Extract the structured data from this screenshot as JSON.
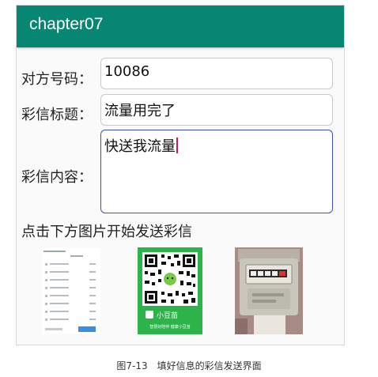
{
  "appbar": {
    "title": "chapter07"
  },
  "form": {
    "phone_label": "对方号码：",
    "phone_value": "10086",
    "subject_label": "彩信标题：",
    "subject_value": "流量用完了",
    "content_label": "彩信内容：",
    "content_value": "快送我流量"
  },
  "hint": "点击下方图片开始发送彩信",
  "qr": {
    "brand": "小豆苗",
    "slogan": "智慧好陪伴 健康小豆苗"
  },
  "caption": "图7-13　填好信息的彩信发送界面",
  "colors": {
    "appbar": "#078674",
    "focus_border": "#3f4fb0",
    "caret": "#c2185b",
    "qr_green": "#2cb34a"
  }
}
